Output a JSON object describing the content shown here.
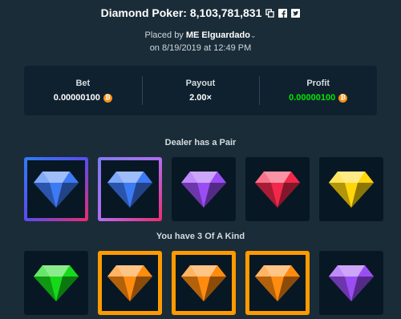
{
  "header": {
    "title": "Diamond Poker: 8,103,781,831",
    "placed_by_prefix": "Placed by",
    "user": "ME Elguardado",
    "date": "on 8/19/2019 at 12:49 PM"
  },
  "stats": {
    "bet_label": "Bet",
    "bet_value": "0.00000100",
    "payout_label": "Payout",
    "payout_value": "2.00×",
    "profit_label": "Profit",
    "profit_value": "0.00000100"
  },
  "dealer": {
    "label": "Dealer has a Pair",
    "gems": [
      "blue",
      "blue",
      "purple",
      "red",
      "yellow"
    ]
  },
  "player": {
    "label": "You have 3 Of A Kind",
    "gems": [
      "green",
      "orange",
      "orange",
      "orange",
      "purple"
    ]
  },
  "colors": {
    "blue": "#3d7af5",
    "purple": "#9b4df5",
    "red": "#f2284b",
    "yellow": "#ffd60a",
    "green": "#16d91a",
    "orange": "#ff8b0f",
    "win_orange": "#ff9a00",
    "profit_green": "#00e701",
    "btc": "#f7931a"
  },
  "icons": {
    "copy": "copy-icon",
    "facebook": "facebook-icon",
    "twitter": "twitter-icon",
    "chevron": "chevron-down-icon",
    "btc": "bitcoin-icon"
  }
}
